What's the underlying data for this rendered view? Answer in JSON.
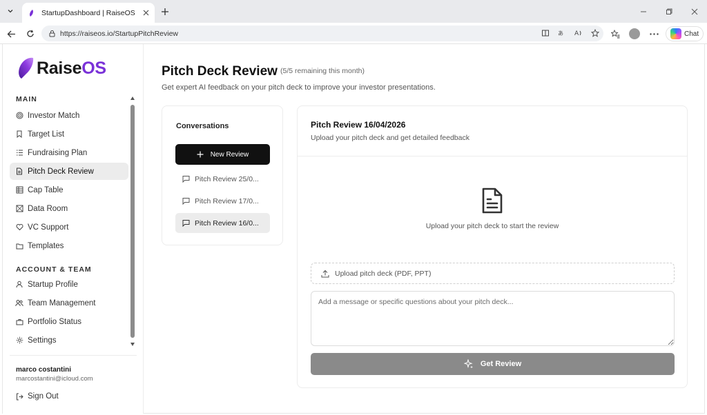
{
  "browser": {
    "tab_title": "StartupDashboard | RaiseOS",
    "url": "https://raiseos.io/StartupPitchReview",
    "chat_label": "Chat"
  },
  "sidebar": {
    "logo_raise": "Raise",
    "logo_os": "OS",
    "sections": [
      {
        "title": "MAIN",
        "items": [
          {
            "label": "Investor Match",
            "icon": "target-icon"
          },
          {
            "label": "Target List",
            "icon": "bookmark-icon"
          },
          {
            "label": "Fundraising Plan",
            "icon": "list-icon"
          },
          {
            "label": "Pitch Deck Review",
            "icon": "document-icon",
            "active": true
          },
          {
            "label": "Cap Table",
            "icon": "table-icon"
          },
          {
            "label": "Data Room",
            "icon": "folder-lock-icon"
          },
          {
            "label": "VC Support",
            "icon": "heart-handshake-icon"
          },
          {
            "label": "Templates",
            "icon": "folder-icon"
          }
        ]
      },
      {
        "title": "ACCOUNT & TEAM",
        "items": [
          {
            "label": "Startup Profile",
            "icon": "user-icon"
          },
          {
            "label": "Team Management",
            "icon": "users-icon"
          },
          {
            "label": "Portfolio Status",
            "icon": "briefcase-icon"
          },
          {
            "label": "Settings",
            "icon": "gear-icon"
          }
        ]
      }
    ],
    "user": {
      "name": "marco costantini",
      "email": "marcostantini@icloud.com"
    },
    "sign_out": "Sign Out"
  },
  "main": {
    "title": "Pitch Deck Review",
    "quota": "(5/5 remaining this month)",
    "subtitle": "Get expert AI feedback on your pitch deck to improve your investor presentations."
  },
  "conversations": {
    "title": "Conversations",
    "new_review": "New Review",
    "items": [
      {
        "label": "Pitch Review 25/0...",
        "active": false
      },
      {
        "label": "Pitch Review 17/0...",
        "active": false
      },
      {
        "label": "Pitch Review 16/0...",
        "active": true
      }
    ]
  },
  "review": {
    "title": "Pitch Review 16/04/2026",
    "subtitle": "Upload your pitch deck and get detailed feedback",
    "empty_text": "Upload your pitch deck to start the review",
    "upload_label": "Upload pitch deck (PDF, PPT)",
    "message_placeholder": "Add a message or specific questions about your pitch deck...",
    "submit_label": "Get Review"
  },
  "colors": {
    "brand_purple": "#7a32d8",
    "primary_button": "#111111",
    "disabled_button": "#8a8a8a",
    "active_item_bg": "#ececec"
  }
}
